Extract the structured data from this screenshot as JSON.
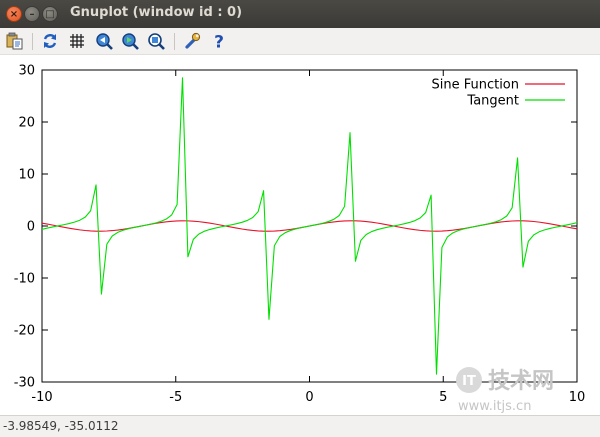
{
  "window": {
    "title": "Gnuplot (window id : 0)",
    "close_glyph": "×",
    "minimize_glyph": "–",
    "maximize_glyph": "□"
  },
  "toolbar": {
    "buttons": [
      {
        "name": "copy-clipboard-icon",
        "tooltip": ""
      },
      {
        "name": "replot-icon"
      },
      {
        "name": "grid-icon"
      },
      {
        "name": "zoom-previous-icon"
      },
      {
        "name": "zoom-next-icon"
      },
      {
        "name": "unzoom-icon"
      },
      {
        "name": "options-wrench-icon"
      },
      {
        "name": "help-icon",
        "glyph": "?"
      }
    ]
  },
  "status": {
    "coords": "-3.98549, -35.0112"
  },
  "watermark": {
    "brand": "技术网",
    "url": "www.itjs.cn",
    "logo_text": "IT"
  },
  "colors": {
    "sine": "#e8132a",
    "tangent": "#00e000",
    "axis": "#000000"
  },
  "chart_data": {
    "type": "line",
    "title": "",
    "xlabel": "",
    "ylabel": "",
    "xlim": [
      -10,
      10
    ],
    "ylim": [
      -30,
      30
    ],
    "xticks": [
      -10,
      -5,
      0,
      5,
      10
    ],
    "yticks": [
      -30,
      -20,
      -10,
      0,
      10,
      20,
      30
    ],
    "legend_position": "top-right",
    "series": [
      {
        "name": "Sine Function",
        "color": "#e8132a",
        "function": "sin(x)",
        "samples": 100
      },
      {
        "name": "Tangent",
        "color": "#00e000",
        "function": "tan(x)",
        "samples": 100
      }
    ]
  }
}
